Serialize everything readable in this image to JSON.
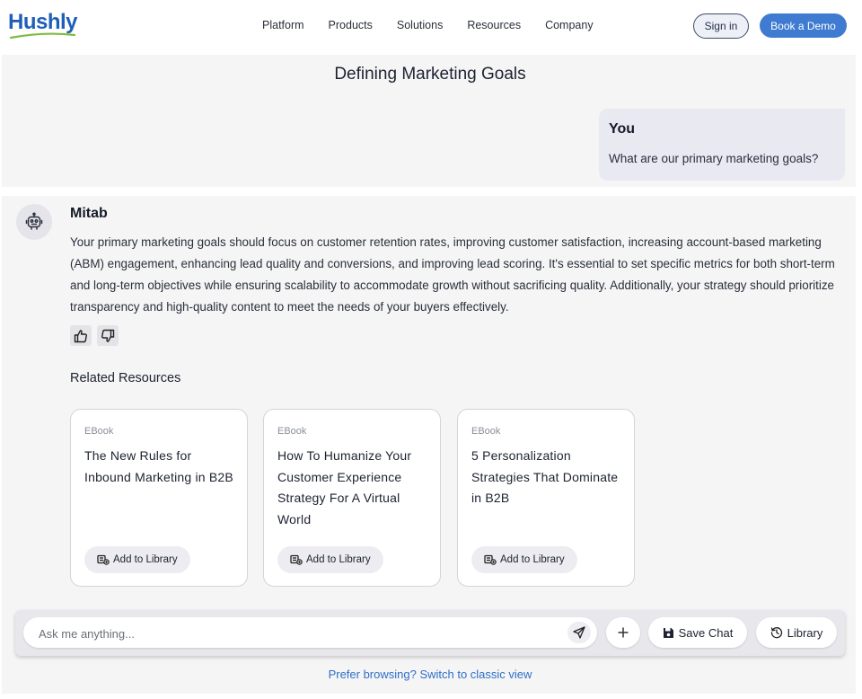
{
  "brand": {
    "name": "Hushly",
    "color": "#1f5fb8",
    "swoosh_color": "#7dbb42"
  },
  "nav": {
    "items": [
      {
        "label": "Platform"
      },
      {
        "label": "Products"
      },
      {
        "label": "Solutions"
      },
      {
        "label": "Resources"
      },
      {
        "label": "Company"
      }
    ],
    "sign_in": "Sign in",
    "book_demo": "Book a Demo"
  },
  "chat": {
    "title": "Defining Marketing Goals",
    "user": {
      "name": "You",
      "message": "What are our primary marketing goals?"
    },
    "bot": {
      "name": "Mitab",
      "avatar_icon": "robot-icon",
      "message": "Your primary marketing goals should focus on customer retention rates, improving customer satisfaction, increasing account-based marketing (ABM) engagement, enhancing lead quality and conversions, and improving lead scoring. It's essential to set specific metrics for both short-term and long-term objectives while ensuring scalability to accommodate growth without sacrificing quality. Additionally, your strategy should prioritize transparency and high-quality content to meet the needs of your buyers effectively."
    },
    "related_title": "Related Resources",
    "resources": [
      {
        "type": "EBook",
        "title": "The New Rules for Inbound Marketing in B2B",
        "button": "Add to Library"
      },
      {
        "type": "EBook",
        "title": "How To Humanize Your Customer Experience Strategy For A Virtual World",
        "button": "Add to Library"
      },
      {
        "type": "EBook",
        "title": "5 Personalization Strategies That Dominate in B2B",
        "button": "Add to Library"
      }
    ]
  },
  "input": {
    "placeholder": "Ask me anything...",
    "save_label": "Save Chat",
    "library_label": "Library"
  },
  "footer": {
    "classic_link": "Prefer browsing? Switch to classic view"
  },
  "colors": {
    "accent": "#3f7bd0",
    "link": "#2f6fc6",
    "panel_bg": "#f5f5f6",
    "user_bubble": "#e9e9f1"
  }
}
